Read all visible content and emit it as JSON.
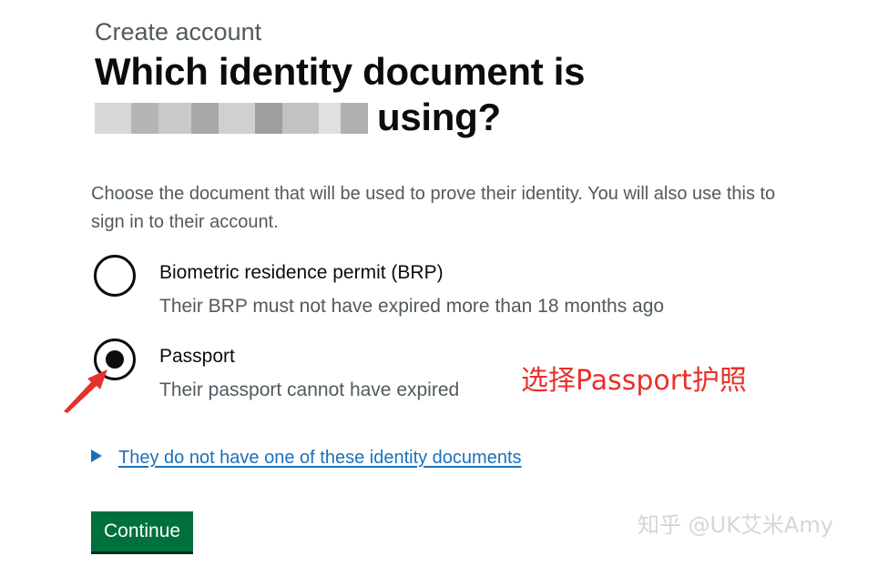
{
  "page": {
    "caption": "Create account",
    "heading_line1": "Which identity document is",
    "heading_line2_suffix": "using?",
    "hint": "Choose the document that will be used to prove their identity. You will also use this to sign in to their account."
  },
  "options": [
    {
      "label": "Biometric residence permit (BRP)",
      "hint": "Their BRP must not have expired more than 18 months ago",
      "selected": false
    },
    {
      "label": "Passport",
      "hint": "Their passport cannot have expired",
      "selected": true
    }
  ],
  "details": {
    "summary": "They do not have one of these identity documents"
  },
  "actions": {
    "continue_label": "Continue"
  },
  "annotation": {
    "text": "选择Passport护照",
    "color": "#e8302a"
  },
  "watermark": {
    "text": "知乎 @UK艾米Amy"
  },
  "colors": {
    "link": "#1d70b8",
    "button": "#00703c",
    "text": "#0b0c0c",
    "secondary_text": "#505a5f"
  }
}
